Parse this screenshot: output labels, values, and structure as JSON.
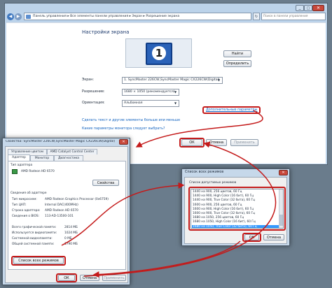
{
  "main_window": {
    "breadcrumb": [
      "Панель управления",
      "Все элементы панели управления",
      "Экран",
      "Разрешение экрана"
    ],
    "search_placeholder": "Поиск в панели управления",
    "title": "Настройки экрана",
    "monitor_number": "1",
    "find_button": "Найти",
    "detect_button": "Определить",
    "screen_label": "Экран:",
    "screen_value": "1. SyncMaster 226CW,SyncMaster Magic CX226CW(Digital)",
    "resolution_label": "Разрешение:",
    "resolution_value": "1680 × 1050 (рекомендуется)",
    "orientation_label": "Ориентация:",
    "orientation_value": "Альбомная",
    "advanced_link": "Дополнительные параметры",
    "link_text_size": "Сделать текст и другие элементы больше или меньше",
    "link_monitor": "Какие параметры монитора следует выбрать?",
    "ok_button": "ОК",
    "cancel_button": "Отмена",
    "apply_button": "Применить"
  },
  "props_dialog": {
    "title": "Свойства: SyncMaster 226CW,SyncMaster Magic CX226CW(Digital)",
    "tabs_top": [
      "Управление цветом",
      "AMD Catalyst Control Center"
    ],
    "tabs_bottom": [
      "Адаптер",
      "Монитор",
      "Диагностика"
    ],
    "adapter_type_label": "Тип адаптера",
    "adapter_name": "AMD Radeon HD 6570",
    "properties_button": "Свойства",
    "info_label": "Сведения об адаптере",
    "info_rows": [
      {
        "k": "Тип микросхем:",
        "v": "AMD Radeon Graphics Processor (0x6759)"
      },
      {
        "k": "Тип ЦАП:",
        "v": "Internal DAC(400MHz)"
      },
      {
        "k": "Строка адаптера:",
        "v": "AMD Radeon HD 6570"
      },
      {
        "k": "Сведения о BIOS:",
        "v": "113-AD-13500-101"
      }
    ],
    "mem_rows": [
      {
        "k": "Всего графической памяти:",
        "v": "2814 МБ"
      },
      {
        "k": "Используется видеопамяти:",
        "v": "1024 МБ"
      },
      {
        "k": "Системной видеопамяти:",
        "v": "0 МБ"
      },
      {
        "k": "Общей системной памяти:",
        "v": "1790 МБ"
      }
    ],
    "list_modes_button": "Список всех режимов",
    "ok_button": "ОК",
    "cancel_button": "Отмена",
    "apply_button": "Применить"
  },
  "modes_dialog": {
    "title": "Список всех режимов",
    "group_label": "Список допустимых режимов",
    "modes": [
      "1440 на 900, 256 цветов, 60 Гц",
      "1440 на 900, High Color (16 бит), 60 Гц",
      "1440 на 900, True Color (32 бита), 60 Гц",
      "1600 на 900, 256 цветов, 60 Гц",
      "1600 на 900, High Color (16 бит), 60 Гц",
      "1600 на 900, True Color (32 бита), 60 Гц",
      "1680 на 1050, 256 цветов, 60 Гц",
      "1680 на 1050, High Color (16 бит), 60 Гц",
      "1680 на 1050, True Color (32 бита), 60 Гц"
    ],
    "ok_button": "ОК",
    "cancel_button": "Отмена"
  },
  "colors": {
    "annotation_red": "#c41a1a",
    "link_blue": "#1565c0",
    "selection_blue": "#3399ff"
  }
}
